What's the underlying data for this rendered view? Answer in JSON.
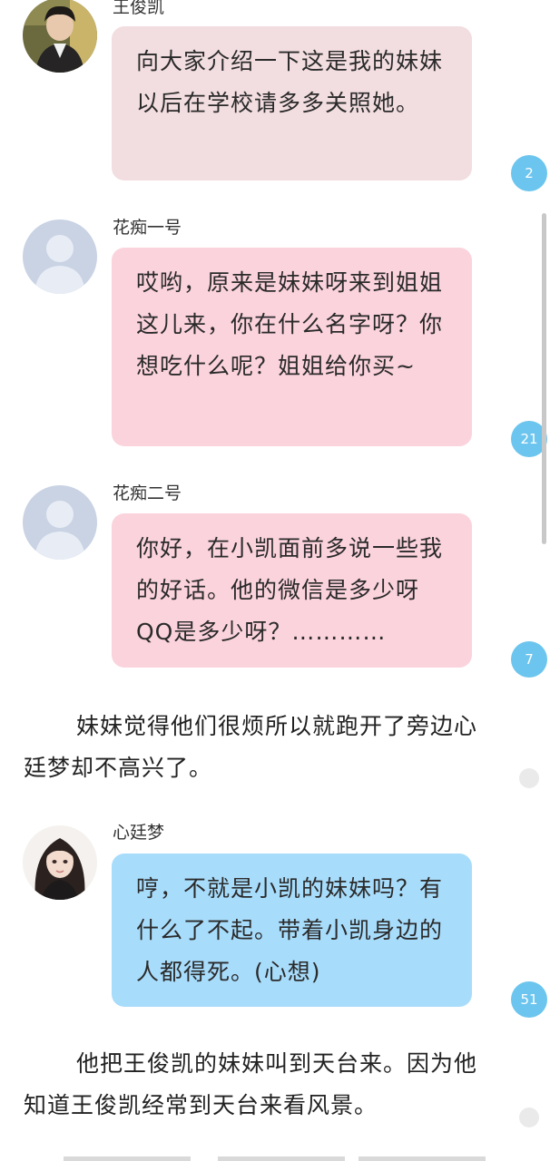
{
  "messages": [
    {
      "speaker": "王俊凯",
      "avatar": "boy-photo-avatar",
      "text": "向大家介绍一下这是我的妹妹以后在学校请多多关照她。",
      "bubble_color": "#f2dde0",
      "comment_count": "2"
    },
    {
      "speaker": "花痴一号",
      "avatar": "default-user-avatar",
      "text": "哎哟，原来是妹妹呀来到姐姐这儿来，你在什么名字呀？你想吃什么呢？姐姐给你买~",
      "bubble_color": "#fbd3dd",
      "comment_count": "21"
    },
    {
      "speaker": "花痴二号",
      "avatar": "default-user-avatar",
      "text": "你好，在小凯面前多说一些我的好话。他的微信是多少呀QQ是多少呀？…………",
      "bubble_color": "#fbd3dd",
      "comment_count": "7"
    },
    {
      "speaker": "心廷梦",
      "avatar": "girl-photo-avatar",
      "text": "哼，不就是小凯的妹妹吗？有什么了不起。带着小凯身边的人都得死。(心想)",
      "bubble_color": "#a8dcfb",
      "comment_count": "51"
    }
  ],
  "paragraphs": [
    "妹妹觉得他们很烦所以就跑开了旁边心廷梦却不高兴了。",
    "他把王俊凯的妹妹叫到天台来。因为他知道王俊凯经常到天台来看风景。"
  ],
  "colors": {
    "badge": "#6cc5ee",
    "badge_empty": "#eaeaea",
    "default_avatar_bg": "#c9d3e4"
  }
}
